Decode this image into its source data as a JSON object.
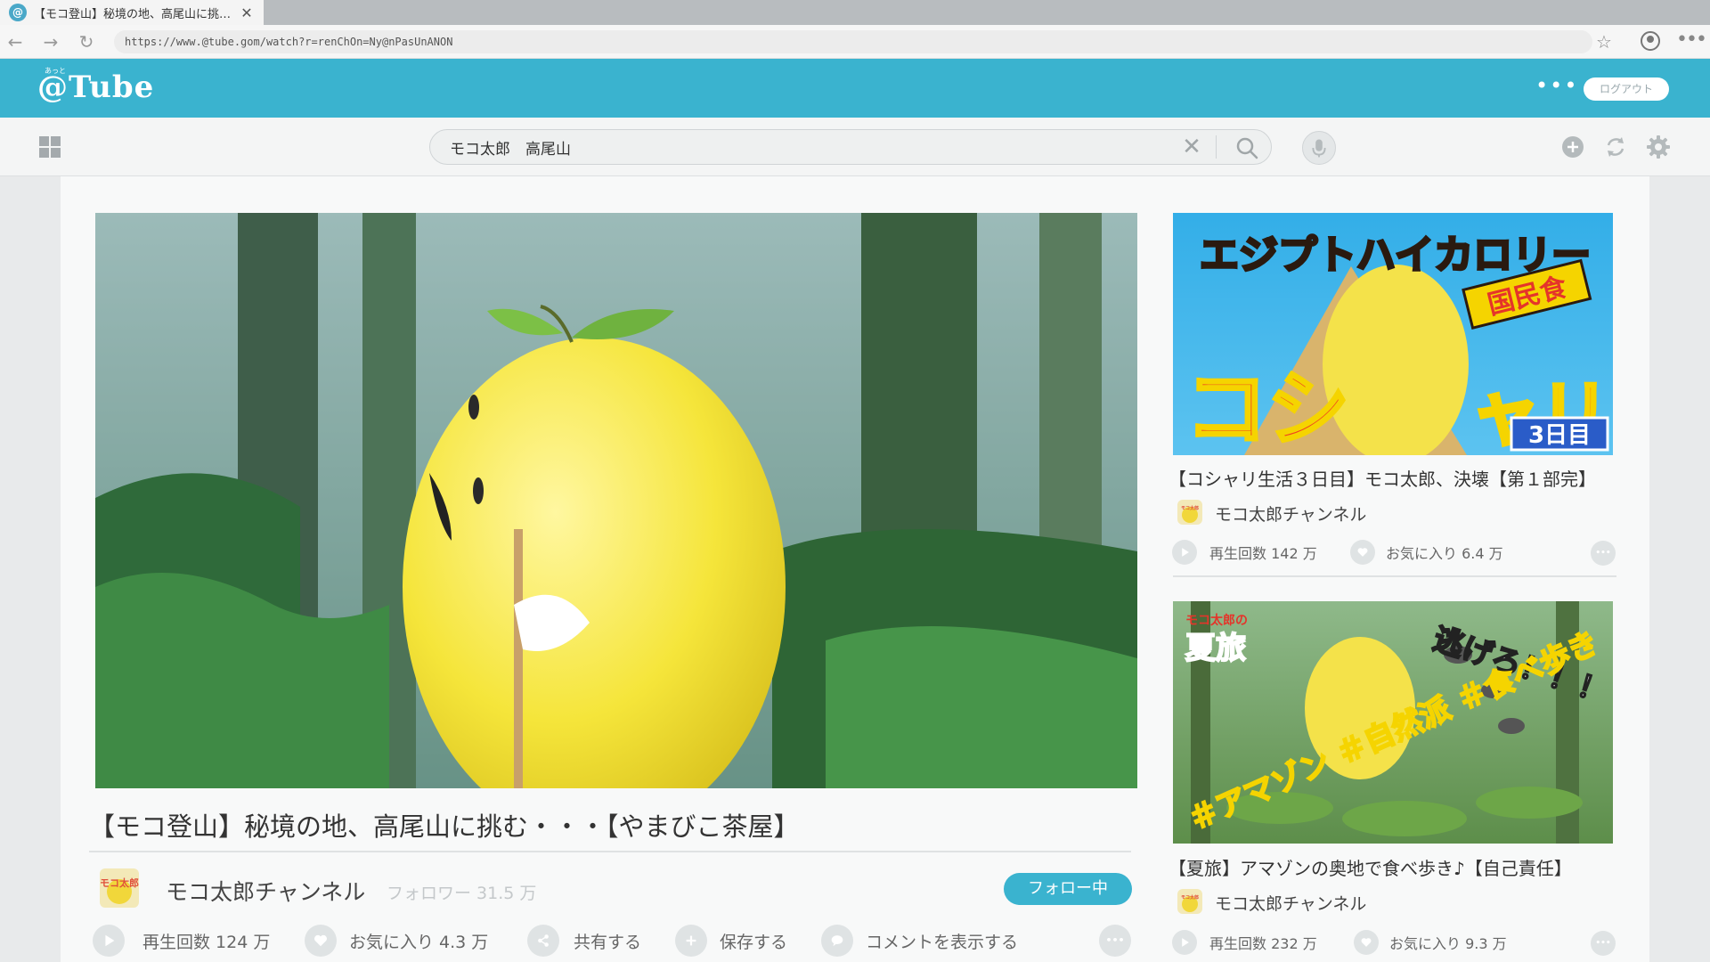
{
  "browser": {
    "tab_title": "【モコ登山】秘境の地、高尾山に挑…",
    "tab_icon_glyph": "@",
    "url": "https://www.@tube.gom/watch?r=renChOn=Ny@nPasUnANON",
    "back_glyph": "←",
    "forward_glyph": "→",
    "reload_glyph": "↻",
    "star_glyph": "☆",
    "menu_glyph": "•••",
    "close_glyph": "✕"
  },
  "header": {
    "logo": "@Tube",
    "logo_ruby": "あっと",
    "dots": "•••",
    "logout_label": "ログアウト",
    "accent_color": "#3ab3cf"
  },
  "toolbar": {
    "search_value": "モコ太郎　高尾山",
    "clear_glyph": "✕",
    "icons": [
      "grid-icon",
      "search-icon",
      "mic-icon",
      "add-icon",
      "sync-icon",
      "gear-icon"
    ]
  },
  "main": {
    "title": "【モコ登山】秘境の地、高尾山に挑む・・・【やまびこ茶屋】",
    "channel_name": "モコ太郎チャンネル",
    "avatar_text": "モコ太郎",
    "followers": "フォロワー 31.5 万",
    "follow_label": "フォロー中",
    "actions": {
      "views": "再生回数 124 万",
      "favorites": "お気に入り 4.3 万",
      "share": "共有する",
      "save": "保存する",
      "comments": "コメントを表示する"
    },
    "more_glyph": "•••"
  },
  "sidebar": {
    "videos": [
      {
        "thumb_text_top": "エジプトハイカロリー",
        "thumb_text_badge": "国民食",
        "thumb_text_left": "コシ",
        "thumb_text_right": "ャリ",
        "thumb_text_day": "3日目",
        "title": "【コシャリ生活３日目】モコ太郎、決壊【第１部完】",
        "channel": "モコ太郎チャンネル",
        "avatar_text": "モコ太郎",
        "views": "再生回数 142 万",
        "favorites": "お気に入り 6.4 万"
      },
      {
        "thumb_text_corner_top": "モコ太郎の",
        "thumb_text_corner": "夏旅",
        "thumb_text_escape": "逃げろ！！！",
        "thumb_text_tags": "＃アマゾン ＃自然派 ＃食べ歩き",
        "title": "【夏旅】アマゾンの奥地で食べ歩き♪【自己責任】",
        "channel": "モコ太郎チャンネル",
        "avatar_text": "モコ太郎",
        "views": "再生回数 232 万",
        "favorites": "お気に入り 9.3 万"
      }
    ]
  }
}
